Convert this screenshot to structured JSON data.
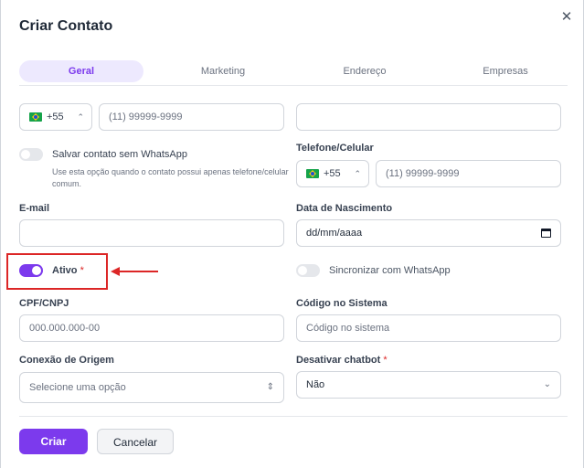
{
  "dialog": {
    "title": "Criar Contato",
    "close_glyph": "✕"
  },
  "tabs": [
    {
      "label": "Geral"
    },
    {
      "label": "Marketing"
    },
    {
      "label": "Endereço"
    },
    {
      "label": "Empresas"
    }
  ],
  "phone_primary": {
    "country_code": "+55",
    "placeholder": "(11) 99999-9999"
  },
  "name_field": {
    "value": ""
  },
  "whatsapp_toggle": {
    "label": "Salvar contato sem WhatsApp",
    "hint": "Use esta opção quando o contato possui apenas telefone/celular comum."
  },
  "telefone": {
    "label": "Telefone/Celular",
    "country_code": "+55",
    "placeholder": "(11) 99999-9999"
  },
  "email": {
    "label": "E-mail",
    "value": ""
  },
  "nascimento": {
    "label": "Data de Nascimento",
    "placeholder": "dd/mm/aaaa"
  },
  "ativo": {
    "label": "Ativo",
    "required_mark": "*"
  },
  "sync_whatsapp": {
    "label": "Sincronizar com WhatsApp"
  },
  "cpf": {
    "label": "CPF/CNPJ",
    "placeholder": "000.000.000-00"
  },
  "codigo": {
    "label": "Código no Sistema",
    "placeholder": "Código no sistema"
  },
  "conexao": {
    "label": "Conexão de Origem",
    "placeholder": "Selecione uma opção"
  },
  "chatbot": {
    "label": "Desativar chatbot",
    "required_mark": "*",
    "value": "Não"
  },
  "actions": {
    "create_label": "Criar",
    "cancel_label": "Cancelar"
  },
  "colors": {
    "accent": "#7c3aed",
    "annotation": "#dc2626"
  }
}
